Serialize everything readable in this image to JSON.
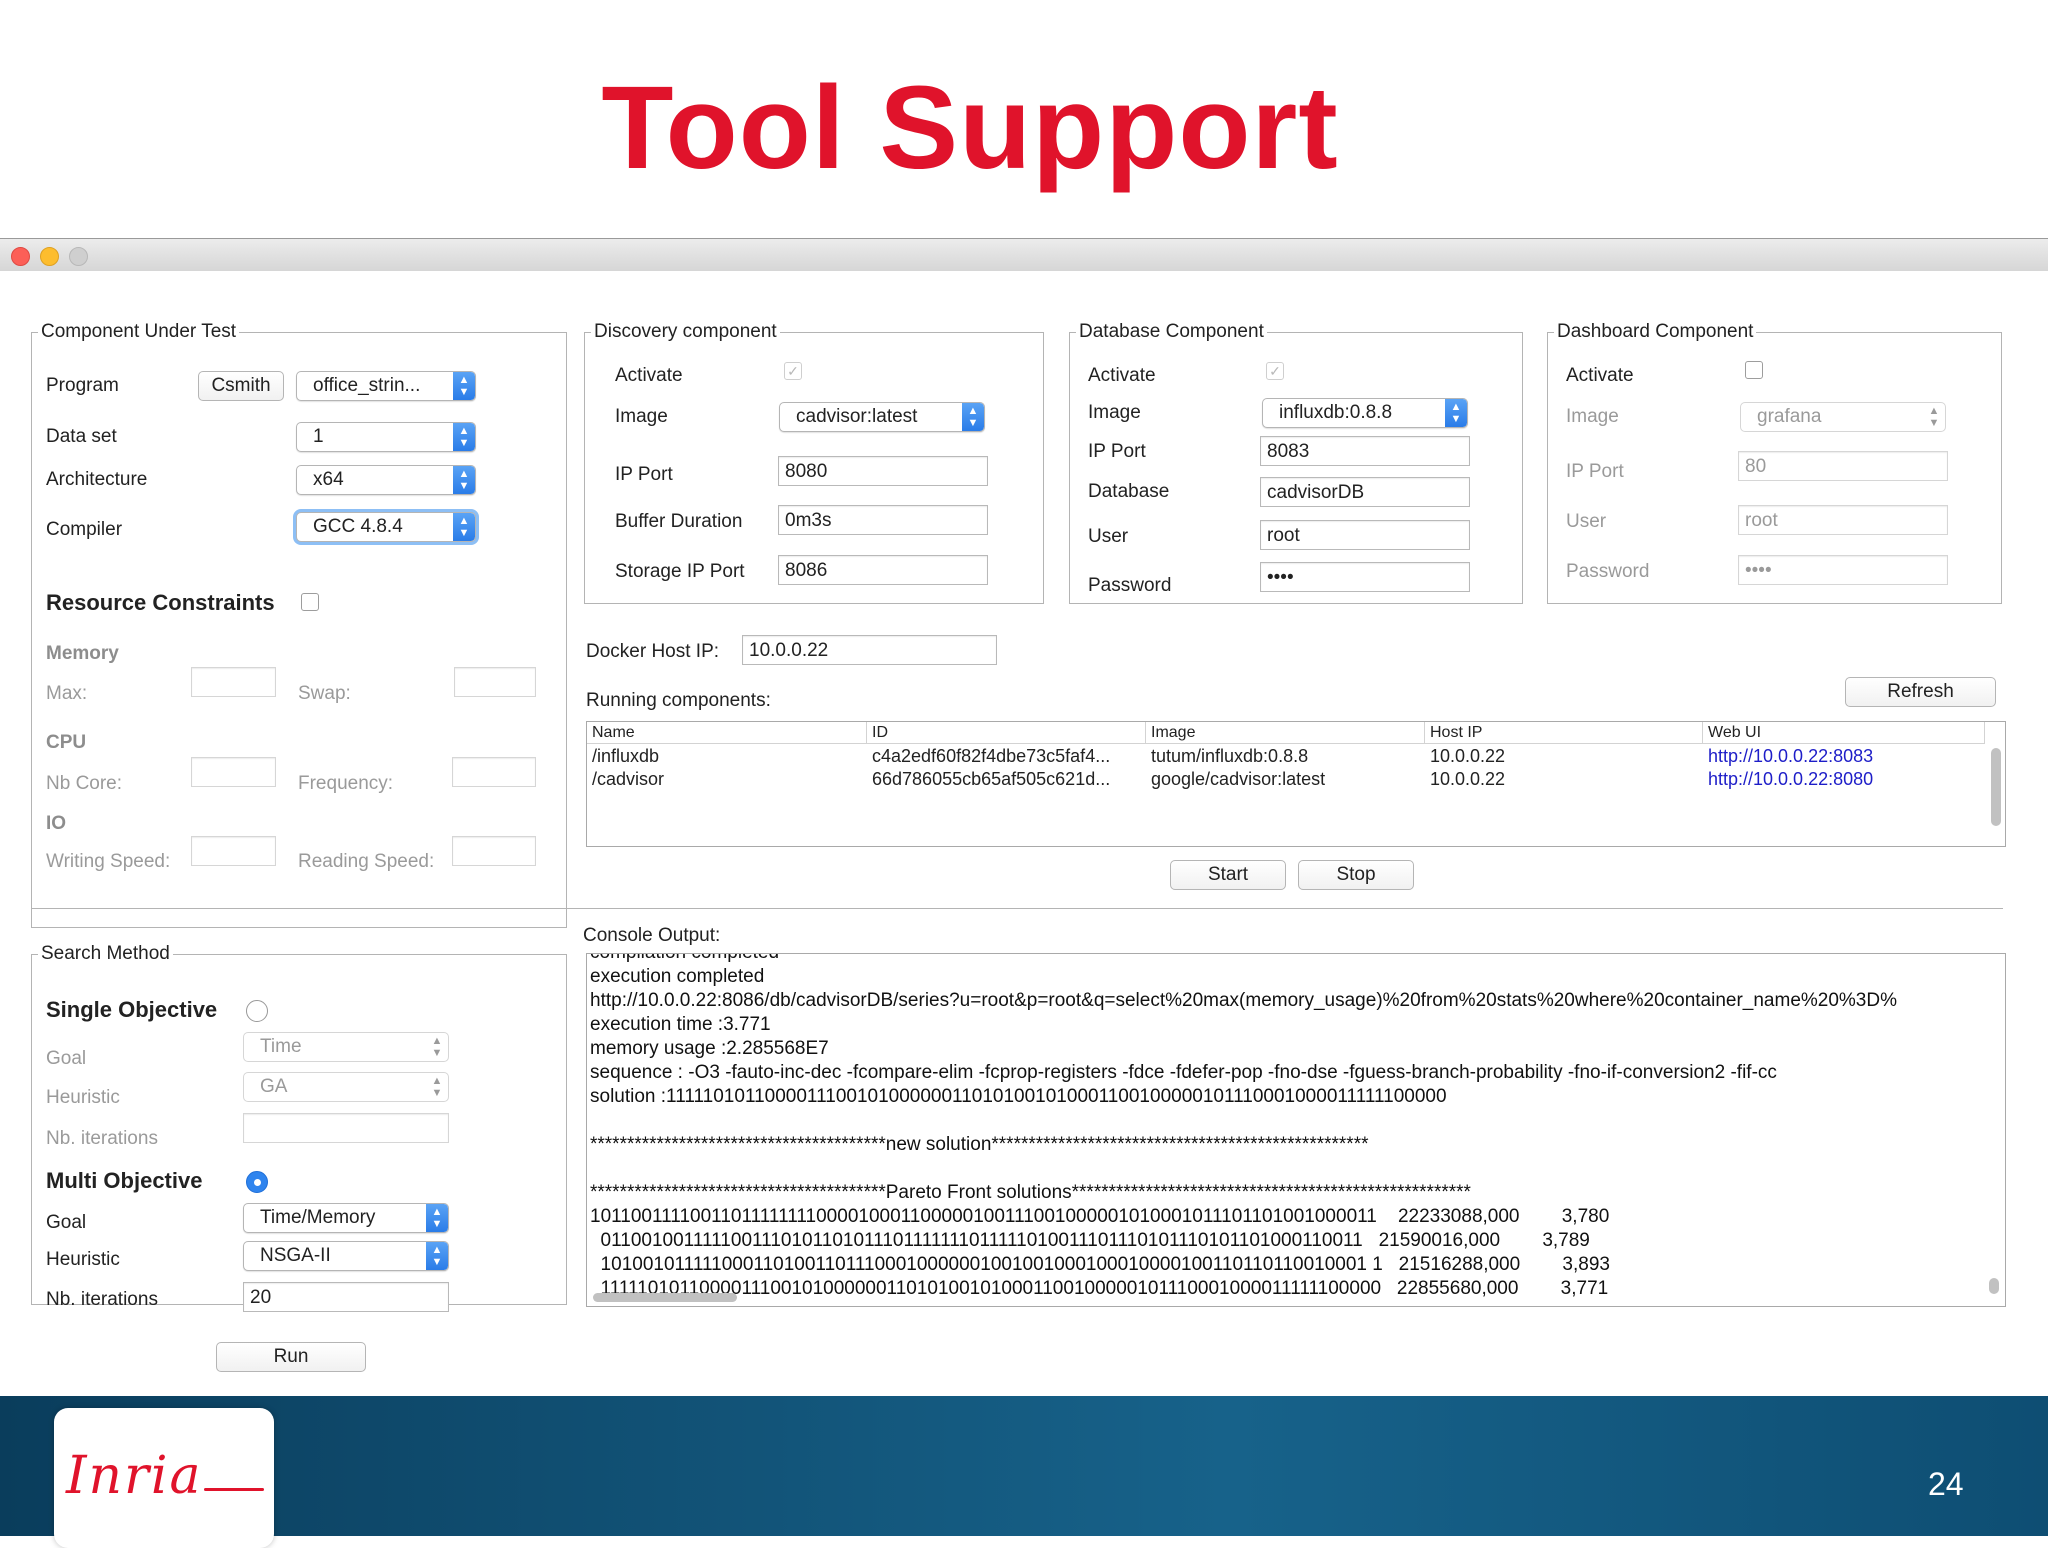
{
  "slide": {
    "title": "Tool Support",
    "page_number": "24",
    "logo": "Inria"
  },
  "cut": {
    "legend": "Component Under Test",
    "program_label": "Program",
    "program_button": "Csmith",
    "program_value": "office_strin...",
    "dataset_label": "Data set",
    "dataset_value": "1",
    "arch_label": "Architecture",
    "arch_value": "x64",
    "compiler_label": "Compiler",
    "compiler_value": "GCC 4.8.4",
    "resource_label": "Resource Constraints",
    "memory_label": "Memory",
    "max_label": "Max:",
    "swap_label": "Swap:",
    "cpu_label": "CPU",
    "nbcore_label": "Nb Core:",
    "freq_label": "Frequency:",
    "io_label": "IO",
    "write_label": "Writing Speed:",
    "read_label": "Reading Speed:"
  },
  "discovery": {
    "legend": "Discovery component",
    "activate_label": "Activate",
    "image_label": "Image",
    "image_value": "cadvisor:latest",
    "ipport_label": "IP Port",
    "ipport_value": "8080",
    "buffer_label": "Buffer Duration",
    "buffer_value": "0m3s",
    "storage_label": "Storage IP Port",
    "storage_value": "8086"
  },
  "database": {
    "legend": "Database Component",
    "activate_label": "Activate",
    "image_label": "Image",
    "image_value": "influxdb:0.8.8",
    "ipport_label": "IP Port",
    "ipport_value": "8083",
    "db_label": "Database",
    "db_value": "cadvisorDB",
    "user_label": "User",
    "user_value": "root",
    "password_label": "Password",
    "password_value": "••••"
  },
  "dashboard": {
    "legend": "Dashboard Component",
    "activate_label": "Activate",
    "image_label": "Image",
    "image_value": "grafana",
    "ipport_label": "IP Port",
    "ipport_value": "80",
    "user_label": "User",
    "user_value": "root",
    "password_label": "Password",
    "password_value": "••••"
  },
  "docker": {
    "host_label": "Docker Host IP:",
    "host_value": "10.0.0.22",
    "running_label": "Running components:",
    "refresh": "Refresh",
    "start": "Start",
    "stop": "Stop",
    "columns": [
      "Name",
      "ID",
      "Image",
      "Host IP",
      "Web UI"
    ],
    "rows": [
      [
        "/influxdb",
        "c4a2edf60f82f4dbe73c5faf4...",
        "tutum/influxdb:0.8.8",
        "10.0.0.22",
        "http://10.0.0.22:8083"
      ],
      [
        "/cadvisor",
        "66d786055cb65af505c621d...",
        "google/cadvisor:latest",
        "10.0.0.22",
        "http://10.0.0.22:8080"
      ]
    ]
  },
  "search": {
    "legend": "Search Method",
    "single_label": "Single Objective",
    "goal_label": "Goal",
    "single_goal": "Time",
    "heuristic_label": "Heuristic",
    "single_heuristic": "GA",
    "iter_label": "Nb. iterations",
    "multi_label": "Multi Objective",
    "multi_goal": "Time/Memory",
    "multi_heuristic": "NSGA-II",
    "multi_iter": "20",
    "run": "Run"
  },
  "console": {
    "label": "Console Output:",
    "lines": [
      "compilation completed",
      "execution completed",
      "http://10.0.0.22:8086/db/cadvisorDB/series?u=root&p=root&q=select%20max(memory_usage)%20from%20stats%20where%20container_name%20%3D%",
      "execution time :3.771",
      "memory usage :2.285568E7",
      "sequence : -O3 -fauto-inc-dec -fcompare-elim -fcprop-registers -fdce -fdefer-pop -fno-dse -fguess-branch-probability -fno-if-conversion2 -fif-cc",
      "solution :1111101011000011100101000000110101001010001100100000101110001000011111100000",
      "",
      "****************************************new solution***************************************************",
      "",
      "****************************************Pareto Front solutions******************************************************",
      "10110011110011011111111000010001100000100111001000001010001011101101001000011    22233088,000        3,780",
      "  0110010011111001110101101011101111111011111010011101110101110101101000110011   21590016,000        3,789",
      "  10100101111100011010011011100010000001001001000100010000100110110110010001 1   21516288,000        3,893",
      "  1111101011000011100101000000110101001010001100100000101110001000011111100000   22855680,000        3,771"
    ]
  }
}
